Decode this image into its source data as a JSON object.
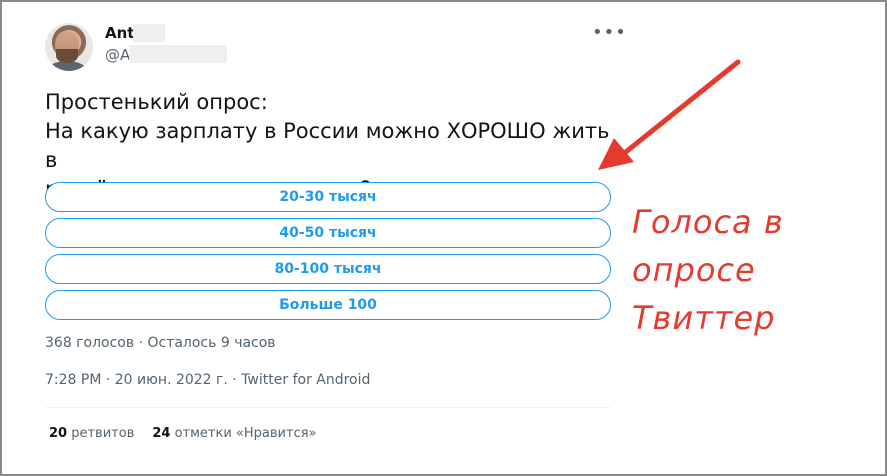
{
  "user": {
    "name": "Ant",
    "handle": "@Ar"
  },
  "tweet": {
    "line1": "Простенький опрос:",
    "line2": "На какую зарплату в России можно ХОРОШО жить в",
    "line3": "расчёте на одного человека?"
  },
  "poll": {
    "options": [
      "20-30 тысяч",
      "40-50 тысяч",
      "80-100 тысяч",
      "Больше 100"
    ],
    "meta": "368 голосов · Осталось 9 часов"
  },
  "timestamp": "7:28 PM · 20 июн. 2022 г. · Twitter for Android",
  "stats": {
    "retweets_count": "20",
    "retweets_label": "ретвитов",
    "likes_count": "24",
    "likes_label": "отметки «Нравится»"
  },
  "annotation": {
    "line1": "Голоса в",
    "line2": "опросе Твиттер",
    "color": "#e53a2e"
  },
  "icons": {
    "more": "more-options-icon"
  },
  "colors": {
    "accent": "#1d9bf0",
    "text": "#0f1419",
    "muted": "#536471",
    "annotation": "#e53a2e"
  }
}
